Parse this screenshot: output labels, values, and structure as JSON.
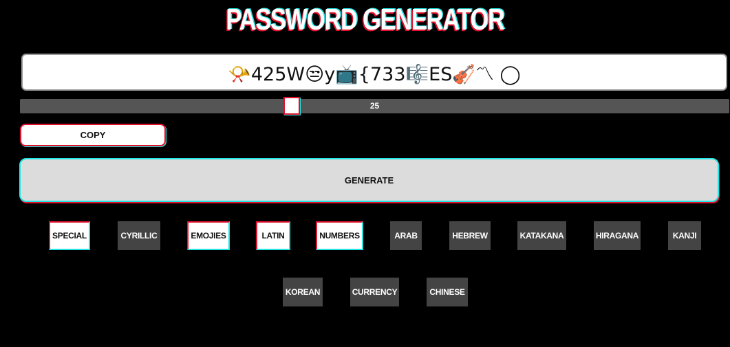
{
  "app": {
    "title": "PASSWORD GENERATOR"
  },
  "password": {
    "value": "📯425W😒y📺{733🎼ES🎻〽 ◯"
  },
  "length": {
    "value": "25",
    "fraction": 0.38
  },
  "buttons": {
    "copy": "COPY",
    "generate": "GENERATE"
  },
  "options": [
    {
      "label": "SPECIAL",
      "on": true
    },
    {
      "label": "CYRILLIC",
      "on": false
    },
    {
      "label": "EMOJIES",
      "on": true
    },
    {
      "label": "LATIN",
      "on": true
    },
    {
      "label": "NUMBERS",
      "on": true
    },
    {
      "label": "ARAB",
      "on": false
    },
    {
      "label": "HEBREW",
      "on": false
    },
    {
      "label": "KATAKANA",
      "on": false
    },
    {
      "label": "HIRAGANA",
      "on": false
    },
    {
      "label": "KANJI",
      "on": false
    },
    {
      "label": "KOREAN",
      "on": false
    },
    {
      "label": "CURRENCY",
      "on": false
    },
    {
      "label": "CHINESE",
      "on": false
    }
  ],
  "colors": {
    "accent_red": "#e0112b",
    "accent_cyan": "#24e6e6",
    "inactive": "#444444"
  }
}
